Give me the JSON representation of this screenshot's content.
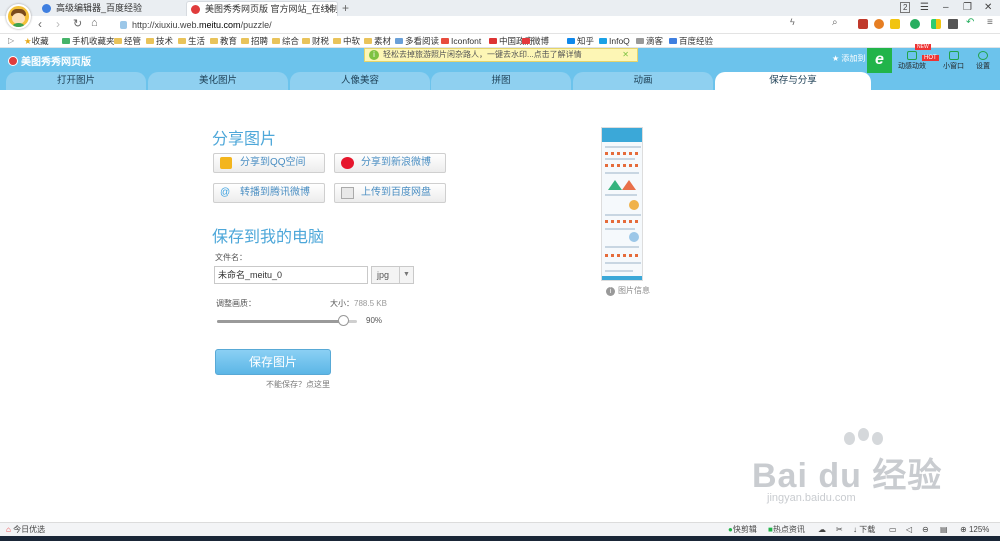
{
  "browser": {
    "tabs": [
      {
        "title": "高级编辑器_百度经验",
        "active": false
      },
      {
        "title": "美图秀秀网页版 官方网站_在线制作",
        "active": true
      }
    ],
    "tab_count": "2",
    "url_prefix": "http://xiuxiu.web.",
    "url_domain": "meitu.com",
    "url_path": "/puzzle/",
    "bookmarks": [
      "收藏",
      "手机收藏夹",
      "经管",
      "技术",
      "生活",
      "教育",
      "招聘",
      "综合",
      "财税",
      "中软",
      "素材",
      "多看阅读",
      "Iconfont",
      "中国政府",
      "微博",
      "知乎",
      "InfoQ",
      "滴客",
      "百度经验"
    ]
  },
  "meitu": {
    "logo_text": "美图秀秀网页版",
    "notice": "轻松去掉旅游照片闲杂路人，一键去水印...点击了解详情",
    "fav_label": "添加到",
    "tools": [
      {
        "label": "动感动效",
        "badge": "HOT"
      },
      {
        "label": "小窗口"
      },
      {
        "label": "设置"
      }
    ],
    "new_badge": "NEW",
    "tabs": [
      "打开图片",
      "美化图片",
      "人像美容",
      "拼图",
      "动画",
      "保存与分享"
    ],
    "active_tab": "保存与分享"
  },
  "share": {
    "heading": "分享图片",
    "buttons": [
      "分享到QQ空间",
      "分享到新浪微博",
      "转播到腾讯微博",
      "上传到百度网盘"
    ]
  },
  "save": {
    "heading": "保存到我的电脑",
    "filename_label": "文件名：",
    "filename_value": "未命名_meitu_0",
    "format": "jpg",
    "quality_label": "调整画质：",
    "size_label": "大小：",
    "size_value": "788.5 KB",
    "quality_value": "90%",
    "quality_fraction": 0.9,
    "save_button": "保存图片",
    "cant_save": "不能保存？点这里"
  },
  "preview": {
    "label": "图片信息"
  },
  "watermark": {
    "brand": "Bai du 经验",
    "url": "jingyan.baidu.com"
  },
  "statusbar": {
    "left": "今日优选",
    "items": [
      "快剪辑",
      "热点资讯",
      "下载"
    ],
    "zoom": "125%"
  },
  "colors": {
    "accent": "#4da7d9",
    "header": "#6cc3ec",
    "green": "#22b44a"
  }
}
